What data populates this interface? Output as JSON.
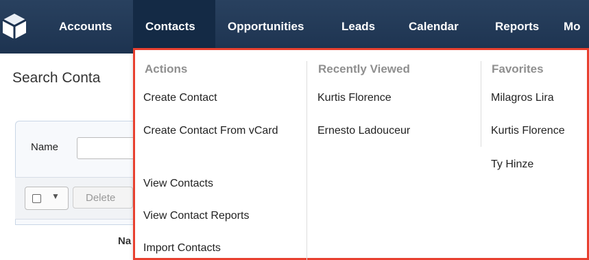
{
  "nav": {
    "logo_icon": "cube-logo-icon",
    "items": [
      "Accounts",
      "Contacts",
      "Opportunities",
      "Leads",
      "Calendar",
      "Reports",
      "Mo"
    ],
    "active": "Contacts"
  },
  "page": {
    "title": "Search Conta",
    "name_label": "Name",
    "delete_label": "Delete",
    "column_header": "Na"
  },
  "menu": {
    "actions": {
      "title": "Actions",
      "items": [
        "Create Contact",
        "Create Contact From vCard",
        "View Contacts",
        "View Contact Reports",
        "Import Contacts"
      ]
    },
    "recently_viewed": {
      "title": "Recently Viewed",
      "items": [
        "Kurtis Florence",
        "Ernesto Ladouceur"
      ]
    },
    "favorites": {
      "title": "Favorites",
      "items": [
        "Milagros Lira",
        "Kurtis Florence",
        "Ty Hinze"
      ]
    }
  },
  "colors": {
    "nav_bg": "#1d3350",
    "nav_active": "#142a45",
    "highlight_border": "#e8402f",
    "section_title": "#8f8f8f"
  }
}
